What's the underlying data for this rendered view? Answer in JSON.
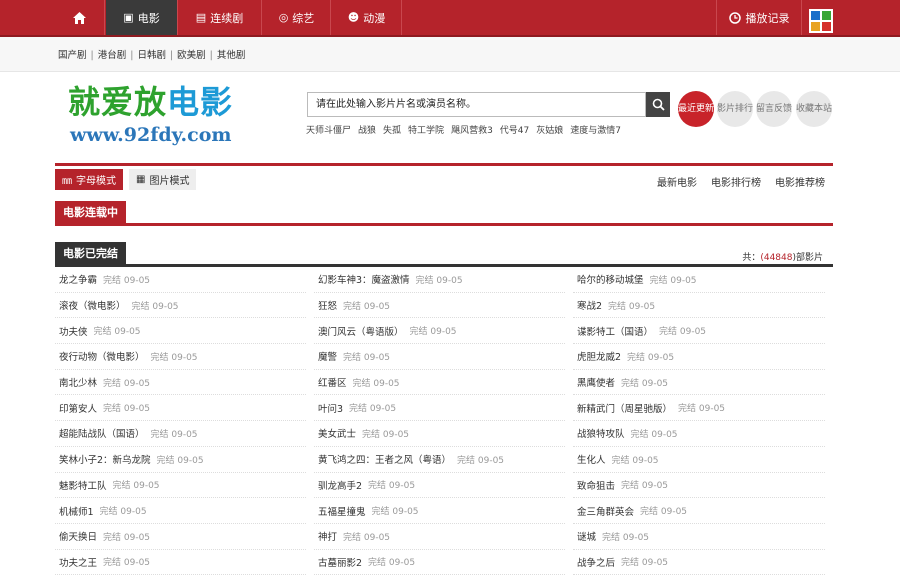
{
  "nav": {
    "items": [
      {
        "label": "",
        "icon": "home-icon"
      },
      {
        "label": "电影",
        "icon": "film-icon"
      },
      {
        "label": "连续剧",
        "icon": "tv-icon"
      },
      {
        "label": "综艺",
        "icon": "star-icon"
      },
      {
        "label": "动漫",
        "icon": "cartoon-icon"
      }
    ],
    "history": "播放记录"
  },
  "subnav": [
    "国产剧",
    "港台剧",
    "日韩剧",
    "欧美剧",
    "其他剧"
  ],
  "logo": {
    "cn_green": "就爱放",
    "cn_blue": "电影",
    "url": "www.92fdy.com"
  },
  "search": {
    "value": "请在此处输入影片片名或演员名称。"
  },
  "hotwords": [
    "天师斗僵尸",
    "战狼",
    "失孤",
    "特工学院",
    "飓风营救3",
    "代号47",
    "灰姑娘",
    "速度与激情7"
  ],
  "circles": [
    {
      "label": "最近更新"
    },
    {
      "label": "影片排行"
    },
    {
      "label": "留言反馈"
    },
    {
      "label": "收藏本站"
    }
  ],
  "modes": {
    "letter": "字母模式",
    "image": "图片模式"
  },
  "mode_links": [
    "最新电影",
    "电影排行榜",
    "电影推荐榜"
  ],
  "section1": "电影连载中",
  "section2": "电影已完结",
  "total": {
    "prefix": "共：",
    "count": "(44848",
    "suffix": ")部影片"
  },
  "status": "完结 09-05",
  "movies": [
    [
      "龙之争霸",
      "幻影车神3：魔盗激情",
      "哈尔的移动城堡"
    ],
    [
      "滚夜（微电影）",
      "狂怒",
      "寒战2"
    ],
    [
      "功夫侠",
      "澳门风云（粤语版）",
      "谍影特工（国语）"
    ],
    [
      "夜行动物（微电影）",
      "魔警",
      "虎胆龙威2"
    ],
    [
      "南北少林",
      "红番区",
      "黑鹰使者"
    ],
    [
      "印第安人",
      "叶问3",
      "新精武门（周星驰版）"
    ],
    [
      "超能陆战队（国语）",
      "美女武士",
      "战狼特攻队"
    ],
    [
      "笑林小子2：新乌龙院",
      "黄飞鸿之四：王者之风（粤语）",
      "生化人"
    ],
    [
      "魅影特工队",
      "驯龙高手2",
      "致命狙击"
    ],
    [
      "机械师1",
      "五福星撞鬼",
      "金三角群英会"
    ],
    [
      "偷天换日",
      "神打",
      "谜城"
    ],
    [
      "功夫之王",
      "古墓丽影2",
      "战争之后"
    ]
  ]
}
